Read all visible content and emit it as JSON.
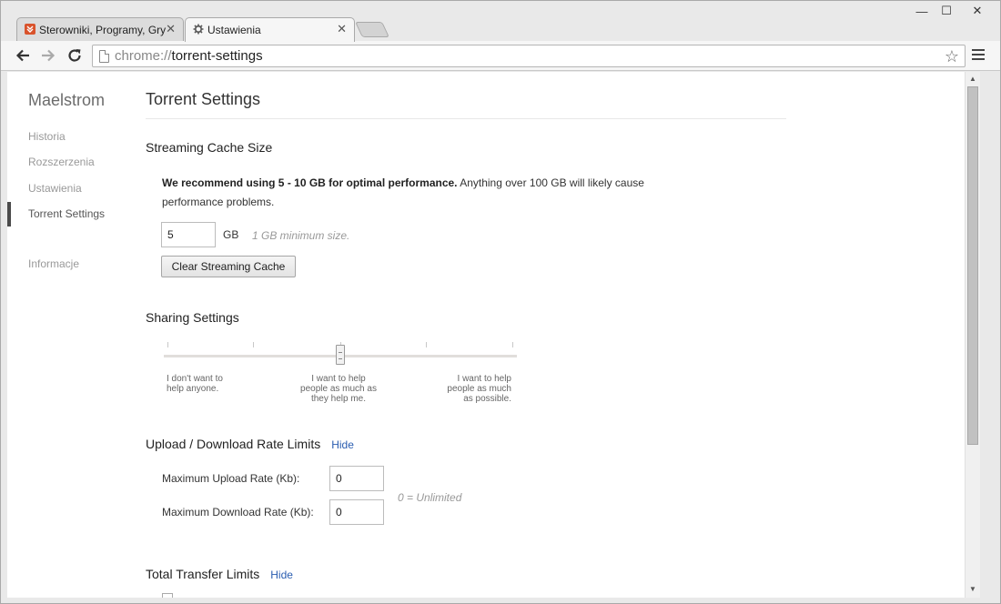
{
  "tabs": [
    {
      "title": "Sterowniki, Programy, Gry",
      "close": "✕"
    },
    {
      "title": "Ustawienia",
      "close": "✕"
    }
  ],
  "window_controls": {
    "minimize": "—",
    "maximize": "☐",
    "close": "✕"
  },
  "toolbar": {
    "url_scheme": "chrome://",
    "url_path": "torrent-settings",
    "back_icon": "arrow-left-icon",
    "forward_icon": "arrow-right-icon",
    "reload_icon": "reload-icon",
    "star": "☆"
  },
  "sidebar": {
    "brand": "Maelstrom",
    "items": [
      {
        "label": "Historia"
      },
      {
        "label": "Rozszerzenia"
      },
      {
        "label": "Ustawienia"
      },
      {
        "label": "Torrent Settings"
      },
      {
        "label": "Informacje"
      }
    ],
    "selected": "Torrent Settings"
  },
  "main": {
    "title": "Torrent Settings",
    "cache": {
      "heading": "Streaming Cache Size",
      "recommend_bold": "We recommend using 5 - 10 GB for optimal performance.",
      "recommend_rest": " Anything over 100 GB will likely cause performance problems.",
      "value": "5",
      "unit": "GB",
      "hint": "1 GB minimum size.",
      "clear_button": "Clear Streaming Cache"
    },
    "sharing": {
      "heading": "Sharing Settings",
      "label_left_1": "I don't want to",
      "label_left_2": "help anyone.",
      "label_mid_1": "I want to help",
      "label_mid_2": "people as much as",
      "label_mid_3": "they help me.",
      "label_right_1": "I want to help",
      "label_right_2": "people as much",
      "label_right_3": "as possible.",
      "slider_value": 0.5
    },
    "rate_limits": {
      "heading": "Upload / Download Rate Limits",
      "toggle": "Hide",
      "upload_label": "Maximum Upload Rate (Kb):",
      "upload_value": "0",
      "download_label": "Maximum Download Rate (Kb):",
      "download_value": "0",
      "hint": "0 = Unlimited"
    },
    "transfer_limits": {
      "heading": "Total Transfer Limits",
      "toggle": "Hide"
    }
  }
}
